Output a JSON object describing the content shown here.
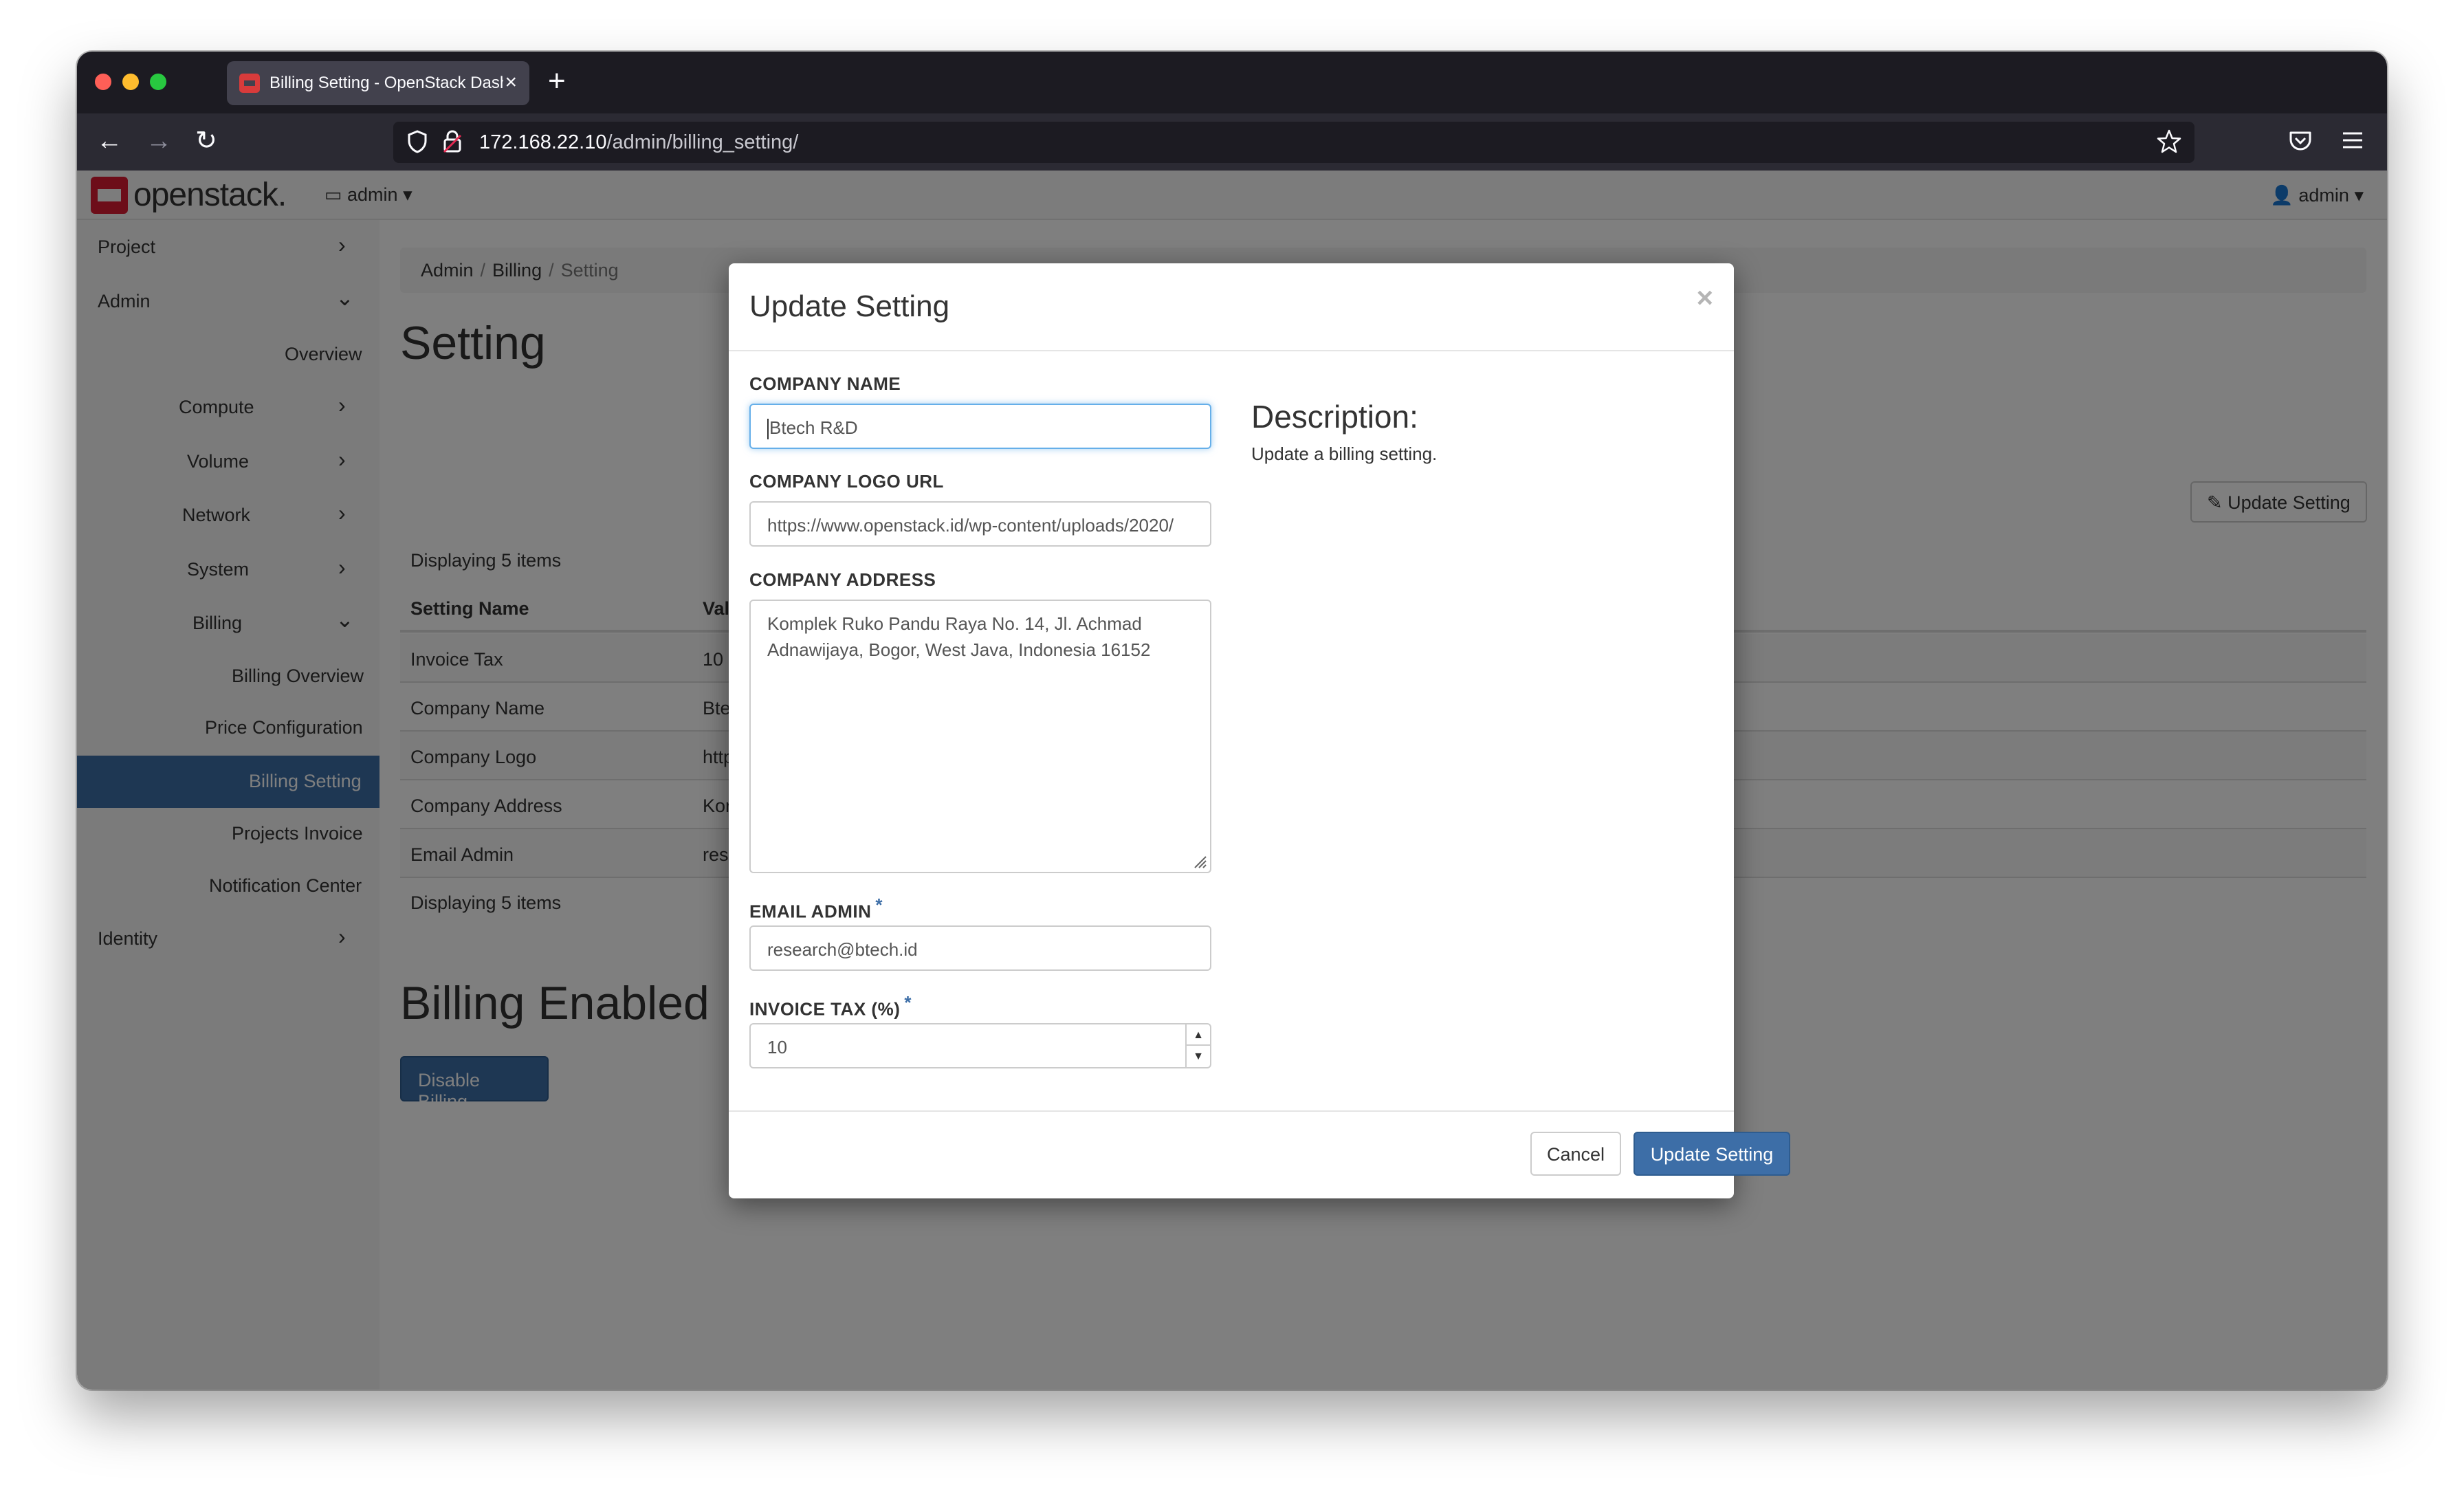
{
  "browser": {
    "tab_title": "Billing Setting - OpenStack Dash",
    "url_host": "172.168.22.10",
    "url_path": "/admin/billing_setting/"
  },
  "header": {
    "logo_text": "openstack.",
    "project_dropdown": "admin",
    "user_dropdown": "admin"
  },
  "sidebar": {
    "items": [
      {
        "label": "Project"
      },
      {
        "label": "Admin"
      },
      {
        "label": "Overview"
      },
      {
        "label": "Compute"
      },
      {
        "label": "Volume"
      },
      {
        "label": "Network"
      },
      {
        "label": "System"
      },
      {
        "label": "Billing"
      },
      {
        "label": "Billing Overview"
      },
      {
        "label": "Price Configuration"
      },
      {
        "label": "Billing Setting"
      },
      {
        "label": "Projects Invoice"
      },
      {
        "label": "Notification Center"
      },
      {
        "label": "Identity"
      }
    ]
  },
  "main": {
    "breadcrumb": [
      "Admin",
      "Billing",
      "Setting"
    ],
    "title": "Setting",
    "update_button": "Update Setting",
    "displaying_top": "Displaying 5 items",
    "displaying_bottom": "Displaying 5 items",
    "table": {
      "headers": [
        "Setting Name",
        "Val"
      ],
      "rows": [
        {
          "name": "Invoice Tax",
          "value": "10"
        },
        {
          "name": "Company Name",
          "value": "Bte"
        },
        {
          "name": "Company Logo",
          "value": "http"
        },
        {
          "name": "Company Address",
          "value": "Kor"
        },
        {
          "name": "Email Admin",
          "value": "rese"
        }
      ]
    },
    "billing_title": "Billing Enabled",
    "disable_button": "Disable Billing"
  },
  "modal": {
    "title": "Update Setting",
    "close": "×",
    "fields": {
      "company_name": {
        "label": "COMPANY NAME",
        "value": "Btech R&D"
      },
      "company_logo_url": {
        "label": "COMPANY LOGO URL",
        "value": "https://www.openstack.id/wp-content/uploads/2020/"
      },
      "company_address": {
        "label": "COMPANY ADDRESS",
        "value": "Komplek Ruko Pandu Raya No. 14, Jl. Achmad Adnawijaya, Bogor, West Java, Indonesia 16152"
      },
      "email_admin": {
        "label": "EMAIL ADMIN",
        "value": "research@btech.id",
        "required": "*"
      },
      "invoice_tax": {
        "label": "INVOICE TAX (%)",
        "value": "10",
        "required": "*"
      }
    },
    "description_title": "Description:",
    "description_text": "Update a billing setting.",
    "cancel_button": "Cancel",
    "submit_button": "Update Setting"
  },
  "colors": {
    "brand_red": "#da1a32",
    "accent_blue": "#3d6ea7",
    "focus_blue": "#66afe9"
  }
}
